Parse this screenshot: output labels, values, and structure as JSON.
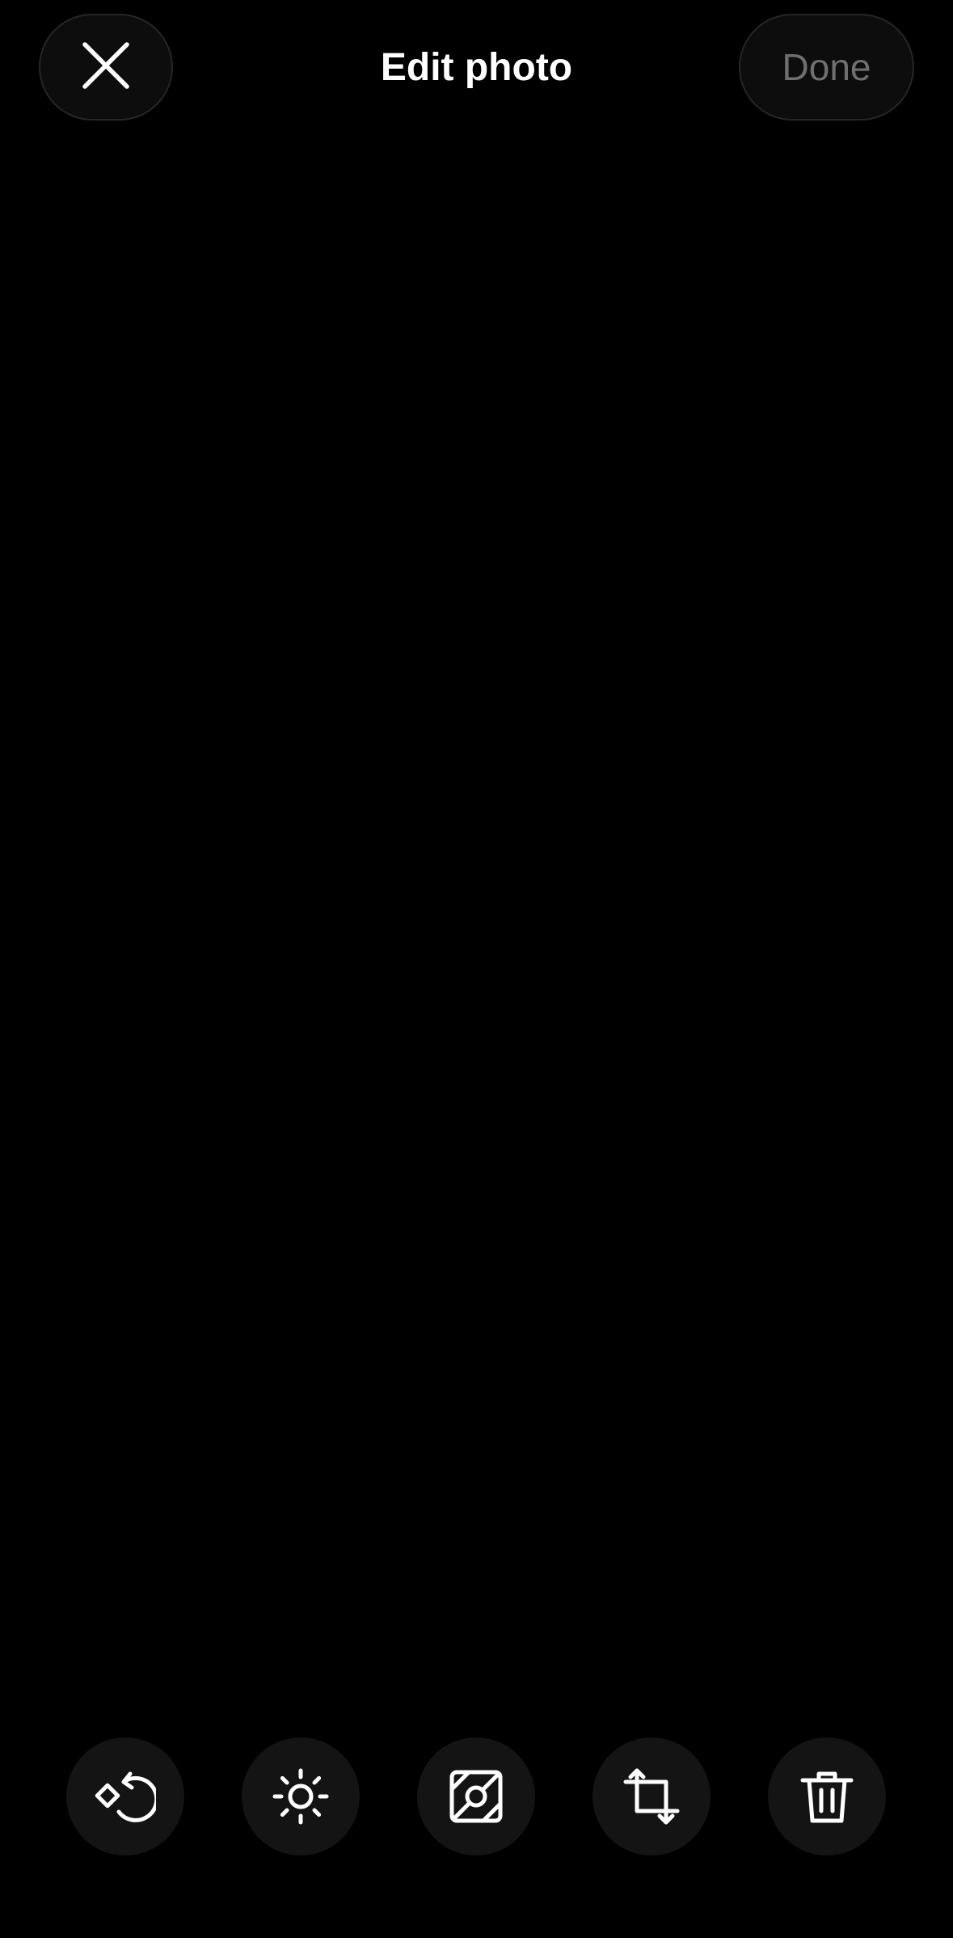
{
  "header": {
    "title": "Edit photo",
    "close_icon": "close-icon",
    "done_label": "Done",
    "done_color": "#6f6f6f"
  },
  "toolbar": {
    "tools": [
      {
        "icon": "rotate-icon"
      },
      {
        "icon": "brightness-icon"
      },
      {
        "icon": "filter-icon"
      },
      {
        "icon": "crop-icon"
      },
      {
        "icon": "trash-icon"
      }
    ]
  },
  "colors": {
    "background": "#000000",
    "button_fill": "#141414",
    "icon": "#ffffff"
  }
}
